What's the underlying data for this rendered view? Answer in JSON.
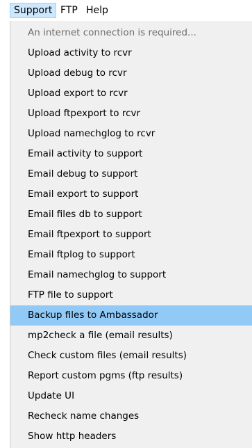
{
  "menubar": {
    "items": [
      {
        "label": "Support"
      },
      {
        "label": "FTP"
      },
      {
        "label": "Help"
      }
    ]
  },
  "support_menu": {
    "items": [
      {
        "label": "An internet connection is required...",
        "disabled": true
      },
      {
        "label": "Upload activity to rcvr"
      },
      {
        "label": "Upload debug to rcvr"
      },
      {
        "label": "Upload export to rcvr"
      },
      {
        "label": "Upload ftpexport to rcvr"
      },
      {
        "label": "Upload namechglog to rcvr"
      },
      {
        "label": "Email activity to support"
      },
      {
        "label": "Email debug to support"
      },
      {
        "label": "Email export to support"
      },
      {
        "label": "Email files db to support"
      },
      {
        "label": "Email ftpexport to support"
      },
      {
        "label": "Email ftplog to support"
      },
      {
        "label": "Email namechglog to support"
      },
      {
        "label": "FTP file to support"
      },
      {
        "label": "Backup files to Ambassador",
        "highlighted": true
      },
      {
        "label": "mp2check a file (email results)"
      },
      {
        "label": "Check custom files (email results)"
      },
      {
        "label": "Report custom pgms (ftp results)"
      },
      {
        "label": "Update UI"
      },
      {
        "label": "Recheck name changes"
      },
      {
        "label": "Show http headers"
      }
    ]
  },
  "colors": {
    "menubar_active_bg": "#cce8ff",
    "dropdown_bg": "#f0f0f0",
    "highlight_bg": "#91c9f7",
    "disabled_text": "#6d6d6d"
  }
}
